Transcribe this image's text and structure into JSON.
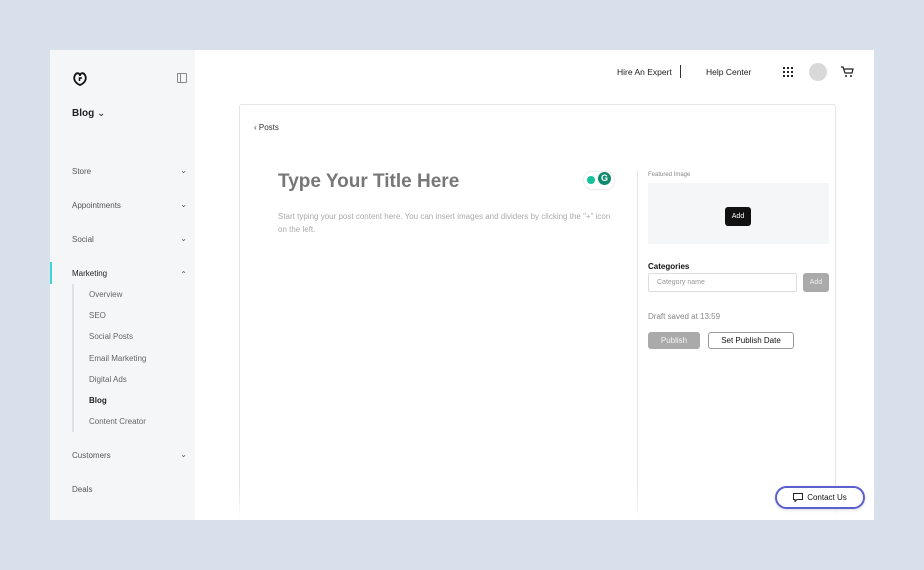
{
  "sidebar": {
    "header": "Blog",
    "items": [
      {
        "label": "Store"
      },
      {
        "label": "Appointments"
      },
      {
        "label": "Social"
      },
      {
        "label": "Marketing"
      },
      {
        "label": "Customers"
      },
      {
        "label": "Deals"
      }
    ],
    "marketing_sub": [
      "Overview",
      "SEO",
      "Social Posts",
      "Email Marketing",
      "Digital Ads",
      "Blog",
      "Content Creator"
    ]
  },
  "topbar": {
    "hire": "Hire An Expert",
    "help": "Help Center"
  },
  "editor": {
    "back": "Posts",
    "title_placeholder": "Type Your Title Here",
    "body_placeholder": "Start typing your post content here. You can insert images and dividers by clicking the \"+\" icon on the left."
  },
  "panel": {
    "featured_label": "Featured Image",
    "featured_add": "Add",
    "categories_label": "Categories",
    "category_placeholder": "Category name",
    "category_add": "Add",
    "draft_status": "Draft saved at 13:59",
    "publish": "Publish",
    "set_date": "Set Publish Date"
  },
  "contact": "Contact Us"
}
